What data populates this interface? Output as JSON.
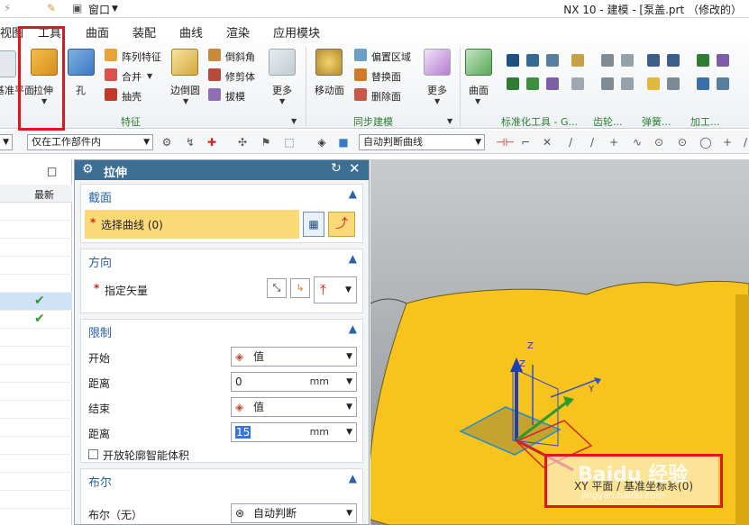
{
  "titlebar": {
    "window_menu": "窗口",
    "title": "NX 10 - 建模 - [泵盖.prt （修改的）"
  },
  "ribbon_tabs": [
    "视图",
    "工具",
    "曲面",
    "装配",
    "曲线",
    "渲染",
    "应用模块"
  ],
  "ribbon": {
    "datum_plane_partial": "基准平面",
    "extrude": "拉伸",
    "hole": "孔",
    "pattern_feature": "阵列特征",
    "unite": "合并",
    "shell": "抽壳",
    "edge_blend": "边倒圆",
    "chamfer": "倒斜角",
    "trim_body": "修剪体",
    "draft": "拔模",
    "more1": "更多",
    "feature_group": "特征",
    "move_face": "移动面",
    "offset_region": "偏置区域",
    "replace_face": "替换面",
    "delete_face": "删除面",
    "more2": "更多",
    "sync_group": "同步建模",
    "surface": "曲面",
    "std_tools_group": "标准化工具 - G...",
    "gear_group": "齿轮...",
    "spring_group": "弹簧...",
    "machining_group": "加工..."
  },
  "toolbar2": {
    "filter": "仅在工作部件内",
    "curve_rule": "自动判断曲线"
  },
  "navigator": {
    "col_latest": "最新"
  },
  "dialog": {
    "title": "拉伸",
    "section": {
      "title": "截面",
      "select_curve": "选择曲线 (0)"
    },
    "direction": {
      "title": "方向",
      "vector": "指定矢量"
    },
    "limits": {
      "title": "限制",
      "start_label": "开始",
      "start_value": "值",
      "start_dist_label": "距离",
      "start_dist": "0",
      "start_unit": "mm",
      "end_label": "结束",
      "end_value": "值",
      "end_dist_label": "距离",
      "end_dist": "15",
      "end_unit": "mm",
      "open_profile": "开放轮廓智能体积"
    },
    "boolean": {
      "title": "布尔",
      "label": "布尔（无）",
      "value": "自动判断"
    }
  },
  "viewport": {
    "tooltip": "XY 平面 / 基准坐标系(0)",
    "axis_x": "X",
    "axis_y": "Y",
    "axis_z": "Z",
    "axis_z2": "Z",
    "watermark": "Baidu 经验",
    "watermark_url": "jingyan.baidu.com"
  }
}
